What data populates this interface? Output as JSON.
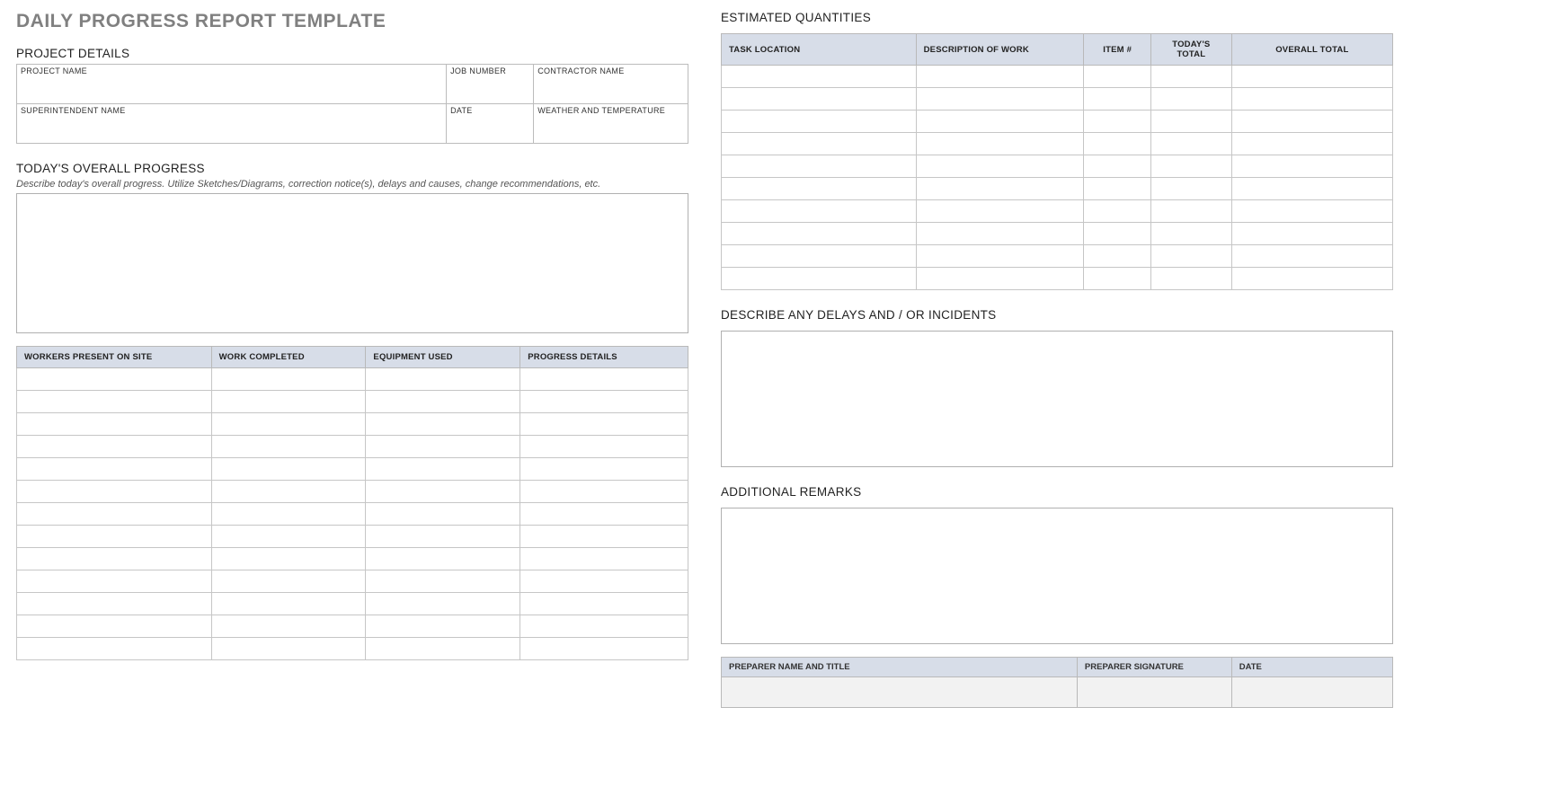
{
  "title": "DAILY PROGRESS REPORT TEMPLATE",
  "project_details": {
    "heading": "PROJECT DETAILS",
    "labels": {
      "project_name": "PROJECT NAME",
      "job_number": "JOB NUMBER",
      "contractor_name": "CONTRACTOR NAME",
      "superintendent_name": "SUPERINTENDENT NAME",
      "date": "DATE",
      "weather": "WEATHER AND TEMPERATURE"
    },
    "values": {
      "project_name": "",
      "job_number": "",
      "contractor_name": "",
      "superintendent_name": "",
      "date": "",
      "weather": ""
    }
  },
  "progress": {
    "heading": "TODAY'S OVERALL PROGRESS",
    "hint": "Describe today's overall progress.  Utilize Sketches/Diagrams, correction notice(s), delays and causes, change recommendations, etc.",
    "value": ""
  },
  "work_table": {
    "headers": [
      "WORKERS PRESENT ON SITE",
      "WORK COMPLETED",
      "EQUIPMENT USED",
      "PROGRESS DETAILS"
    ],
    "rows": [
      [
        "",
        "",
        "",
        ""
      ],
      [
        "",
        "",
        "",
        ""
      ],
      [
        "",
        "",
        "",
        ""
      ],
      [
        "",
        "",
        "",
        ""
      ],
      [
        "",
        "",
        "",
        ""
      ],
      [
        "",
        "",
        "",
        ""
      ],
      [
        "",
        "",
        "",
        ""
      ],
      [
        "",
        "",
        "",
        ""
      ],
      [
        "",
        "",
        "",
        ""
      ],
      [
        "",
        "",
        "",
        ""
      ],
      [
        "",
        "",
        "",
        ""
      ],
      [
        "",
        "",
        "",
        ""
      ],
      [
        "",
        "",
        "",
        ""
      ]
    ]
  },
  "quantities": {
    "heading": "ESTIMATED QUANTITIES",
    "headers": [
      "TASK LOCATION",
      "DESCRIPTION OF WORK",
      "ITEM #",
      "TODAY'S TOTAL",
      "OVERALL TOTAL"
    ],
    "rows": [
      [
        "",
        "",
        "",
        "",
        ""
      ],
      [
        "",
        "",
        "",
        "",
        ""
      ],
      [
        "",
        "",
        "",
        "",
        ""
      ],
      [
        "",
        "",
        "",
        "",
        ""
      ],
      [
        "",
        "",
        "",
        "",
        ""
      ],
      [
        "",
        "",
        "",
        "",
        ""
      ],
      [
        "",
        "",
        "",
        "",
        ""
      ],
      [
        "",
        "",
        "",
        "",
        ""
      ],
      [
        "",
        "",
        "",
        "",
        ""
      ],
      [
        "",
        "",
        "",
        "",
        ""
      ]
    ]
  },
  "delays": {
    "heading": "DESCRIBE ANY DELAYS AND / OR INCIDENTS",
    "value": ""
  },
  "remarks": {
    "heading": "ADDITIONAL REMARKS",
    "value": ""
  },
  "preparer": {
    "headers": [
      "PREPARER NAME AND TITLE",
      "PREPARER SIGNATURE",
      "DATE"
    ],
    "values": [
      "",
      "",
      ""
    ]
  }
}
